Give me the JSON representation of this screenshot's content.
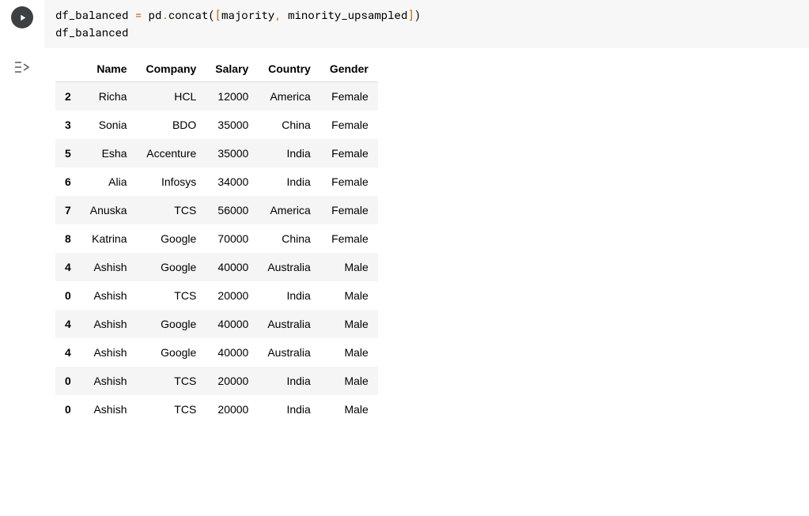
{
  "code": {
    "line1": {
      "lhs": "df_balanced",
      "eq": " = ",
      "obj": "pd",
      "dot": ".",
      "fn": "concat",
      "lparen": "(",
      "lbrack": "[",
      "arg1": "majority",
      "comma": ", ",
      "arg2": "minority_upsampled",
      "rbrack": "]",
      "rparen": ")"
    },
    "line2": "df_balanced"
  },
  "table": {
    "columns": [
      "Name",
      "Company",
      "Salary",
      "Country",
      "Gender"
    ],
    "rows": [
      {
        "idx": "2",
        "cells": [
          "Richa",
          "HCL",
          "12000",
          "America",
          "Female"
        ]
      },
      {
        "idx": "3",
        "cells": [
          "Sonia",
          "BDO",
          "35000",
          "China",
          "Female"
        ]
      },
      {
        "idx": "5",
        "cells": [
          "Esha",
          "Accenture",
          "35000",
          "India",
          "Female"
        ]
      },
      {
        "idx": "6",
        "cells": [
          "Alia",
          "Infosys",
          "34000",
          "India",
          "Female"
        ]
      },
      {
        "idx": "7",
        "cells": [
          "Anuska",
          "TCS",
          "56000",
          "America",
          "Female"
        ]
      },
      {
        "idx": "8",
        "cells": [
          "Katrina",
          "Google",
          "70000",
          "China",
          "Female"
        ]
      },
      {
        "idx": "4",
        "cells": [
          "Ashish",
          "Google",
          "40000",
          "Australia",
          "Male"
        ]
      },
      {
        "idx": "0",
        "cells": [
          "Ashish",
          "TCS",
          "20000",
          "India",
          "Male"
        ]
      },
      {
        "idx": "4",
        "cells": [
          "Ashish",
          "Google",
          "40000",
          "Australia",
          "Male"
        ]
      },
      {
        "idx": "4",
        "cells": [
          "Ashish",
          "Google",
          "40000",
          "Australia",
          "Male"
        ]
      },
      {
        "idx": "0",
        "cells": [
          "Ashish",
          "TCS",
          "20000",
          "India",
          "Male"
        ]
      },
      {
        "idx": "0",
        "cells": [
          "Ashish",
          "TCS",
          "20000",
          "India",
          "Male"
        ]
      }
    ]
  }
}
